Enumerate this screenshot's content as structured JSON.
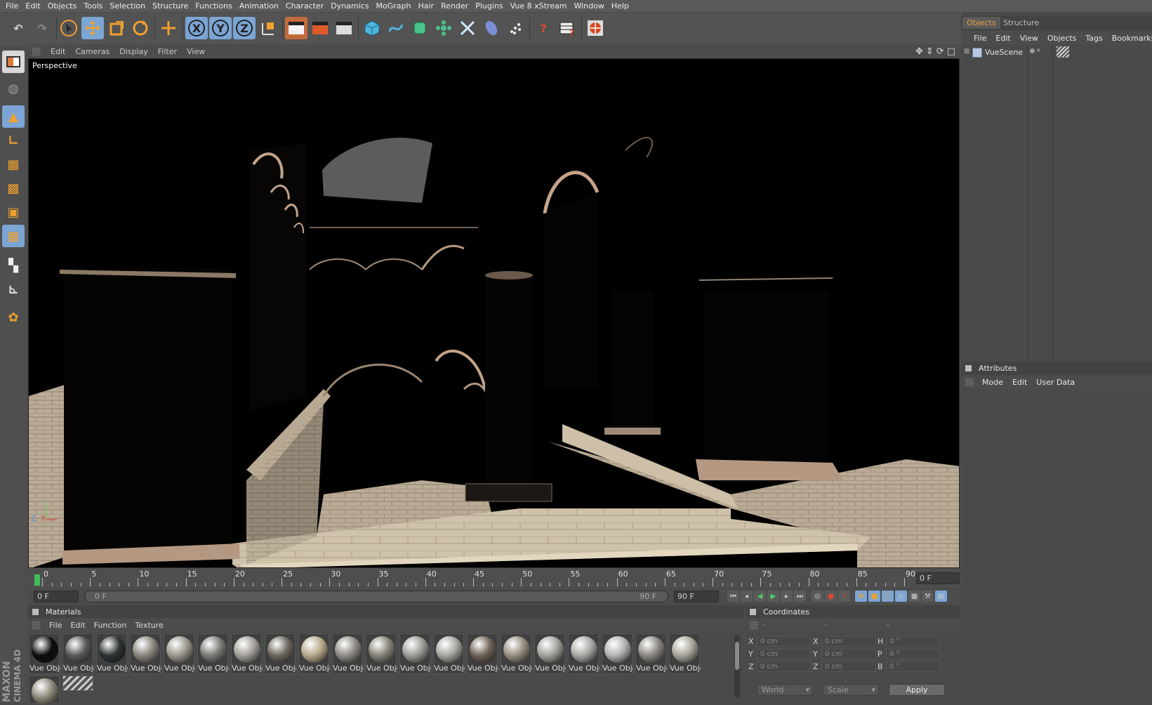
{
  "menubar": [
    "File",
    "Edit",
    "Objects",
    "Tools",
    "Selection",
    "Structure",
    "Functions",
    "Animation",
    "Character",
    "Dynamics",
    "MoGraph",
    "Hair",
    "Render",
    "Plugins",
    "Vue 8 xStream",
    "Window",
    "Help"
  ],
  "toolbar": {
    "undo": "↶",
    "redo": "↷",
    "axis_x": "X",
    "axis_y": "Y",
    "axis_z": "Z"
  },
  "viewport": {
    "menu": [
      "Edit",
      "Cameras",
      "Display",
      "Filter",
      "View"
    ],
    "camera_label": "Perspective",
    "axis_z": "Z",
    "axis_x": "X"
  },
  "timeline": {
    "ticks": [
      "0",
      "5",
      "10",
      "15",
      "20",
      "25",
      "30",
      "35",
      "40",
      "45",
      "50",
      "55",
      "60",
      "65",
      "70",
      "75",
      "80",
      "85",
      "90"
    ],
    "current_frame": "0 F"
  },
  "range": {
    "start": "0 F",
    "slider_start": "0 F",
    "slider_end": "90 F",
    "end": "90 F"
  },
  "materials": {
    "title": "Materials",
    "menu": [
      "File",
      "Edit",
      "Function",
      "Texture"
    ],
    "items": [
      {
        "label": "Vue Obje",
        "color": "#0c0c0c"
      },
      {
        "label": "Vue Obje",
        "color": "#5a5a5a"
      },
      {
        "label": "Vue Obje",
        "color": "#2d3234"
      },
      {
        "label": "Vue Obje",
        "color": "#8a857c"
      },
      {
        "label": "Vue Obje",
        "color": "#9b968c"
      },
      {
        "label": "Vue Obje",
        "color": "#7c7a75"
      },
      {
        "label": "Vue Obje",
        "color": "#a19e96"
      },
      {
        "label": "Vue Obje",
        "color": "#6d665d"
      },
      {
        "label": "Vue Obje",
        "color": "#b6a88a"
      },
      {
        "label": "Vue Obje",
        "color": "#8f8b84"
      },
      {
        "label": "Vue Obje",
        "color": "#858378"
      },
      {
        "label": "Vue Obje",
        "color": "#9c9a94"
      },
      {
        "label": "Vue Obje",
        "color": "#a8a6a0"
      },
      {
        "label": "Vue Obje",
        "color": "#6e6256"
      },
      {
        "label": "Vue Obje",
        "color": "#958c7d"
      },
      {
        "label": "Vue Obje",
        "color": "#a3a19b"
      },
      {
        "label": "Vue Obje",
        "color": "#a7a7a4"
      },
      {
        "label": "Vue Obje",
        "color": "#b2b2b0"
      },
      {
        "label": "Vue Obje",
        "color": "#8a8780"
      },
      {
        "label": "Vue Obje",
        "color": "#a8a49a"
      }
    ],
    "extra": [
      {
        "color": "#8d8778"
      }
    ]
  },
  "coordinates": {
    "title": "Coordinates",
    "col_headers": [
      "–",
      "–",
      "–"
    ],
    "rows": [
      {
        "a": "X",
        "av": "0 cm",
        "b": "X",
        "bv": "0 cm",
        "c": "H",
        "cv": "0 °"
      },
      {
        "a": "Y",
        "av": "0 cm",
        "b": "Y",
        "bv": "0 cm",
        "c": "P",
        "cv": "0 °"
      },
      {
        "a": "Z",
        "av": "0 cm",
        "b": "Z",
        "bv": "0 cm",
        "c": "B",
        "cv": "0 °"
      }
    ],
    "mode": "World",
    "transform": "Scale",
    "apply": "Apply"
  },
  "objects": {
    "tabs": [
      "Objects",
      "Structure"
    ],
    "menu": [
      "File",
      "Edit",
      "View",
      "Objects",
      "Tags",
      "Bookmarks"
    ],
    "items": [
      {
        "name": "VueScene"
      }
    ]
  },
  "attributes": {
    "title": "Attributes",
    "menu": [
      "Mode",
      "Edit",
      "User Data"
    ]
  },
  "brand": {
    "line1": "MAXON",
    "line2": "CINEMA 4D"
  },
  "colors": {
    "accent": "#7aa5d4",
    "orange": "#f0a030",
    "tab_active": "#e6a23c"
  }
}
